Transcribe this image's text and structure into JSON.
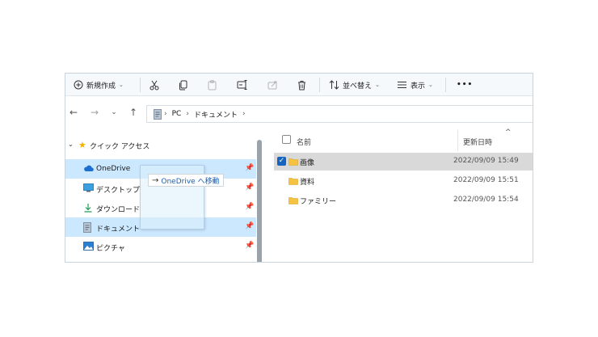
{
  "toolbar": {
    "new_label": "新規作成",
    "sort_label": "並べ替え",
    "view_label": "表示",
    "more_label": "•••"
  },
  "address": {
    "segments": [
      "PC",
      "ドキュメント"
    ]
  },
  "nav": {
    "back": "←",
    "forward": "→",
    "recent": "⌄",
    "up": "↑"
  },
  "sidebar": {
    "quick_access": "クイック アクセス",
    "items": [
      {
        "label": "OneDrive"
      },
      {
        "label": "デスクトップ"
      },
      {
        "label": "ダウンロード"
      },
      {
        "label": "ドキュメント"
      },
      {
        "label": "ピクチャ"
      }
    ]
  },
  "drag": {
    "tooltip": "OneDrive へ移動"
  },
  "columns": {
    "name": "名前",
    "date": "更新日時"
  },
  "files": [
    {
      "name": "画像",
      "date": "2022/09/09 15:49",
      "selected": true
    },
    {
      "name": "資料",
      "date": "2022/09/09 15:51",
      "selected": false
    },
    {
      "name": "ファミリー",
      "date": "2022/09/09 15:54",
      "selected": false
    }
  ],
  "colors": {
    "accent": "#1565c0",
    "selection": "#cce8ff",
    "folder": "#f5c242"
  }
}
